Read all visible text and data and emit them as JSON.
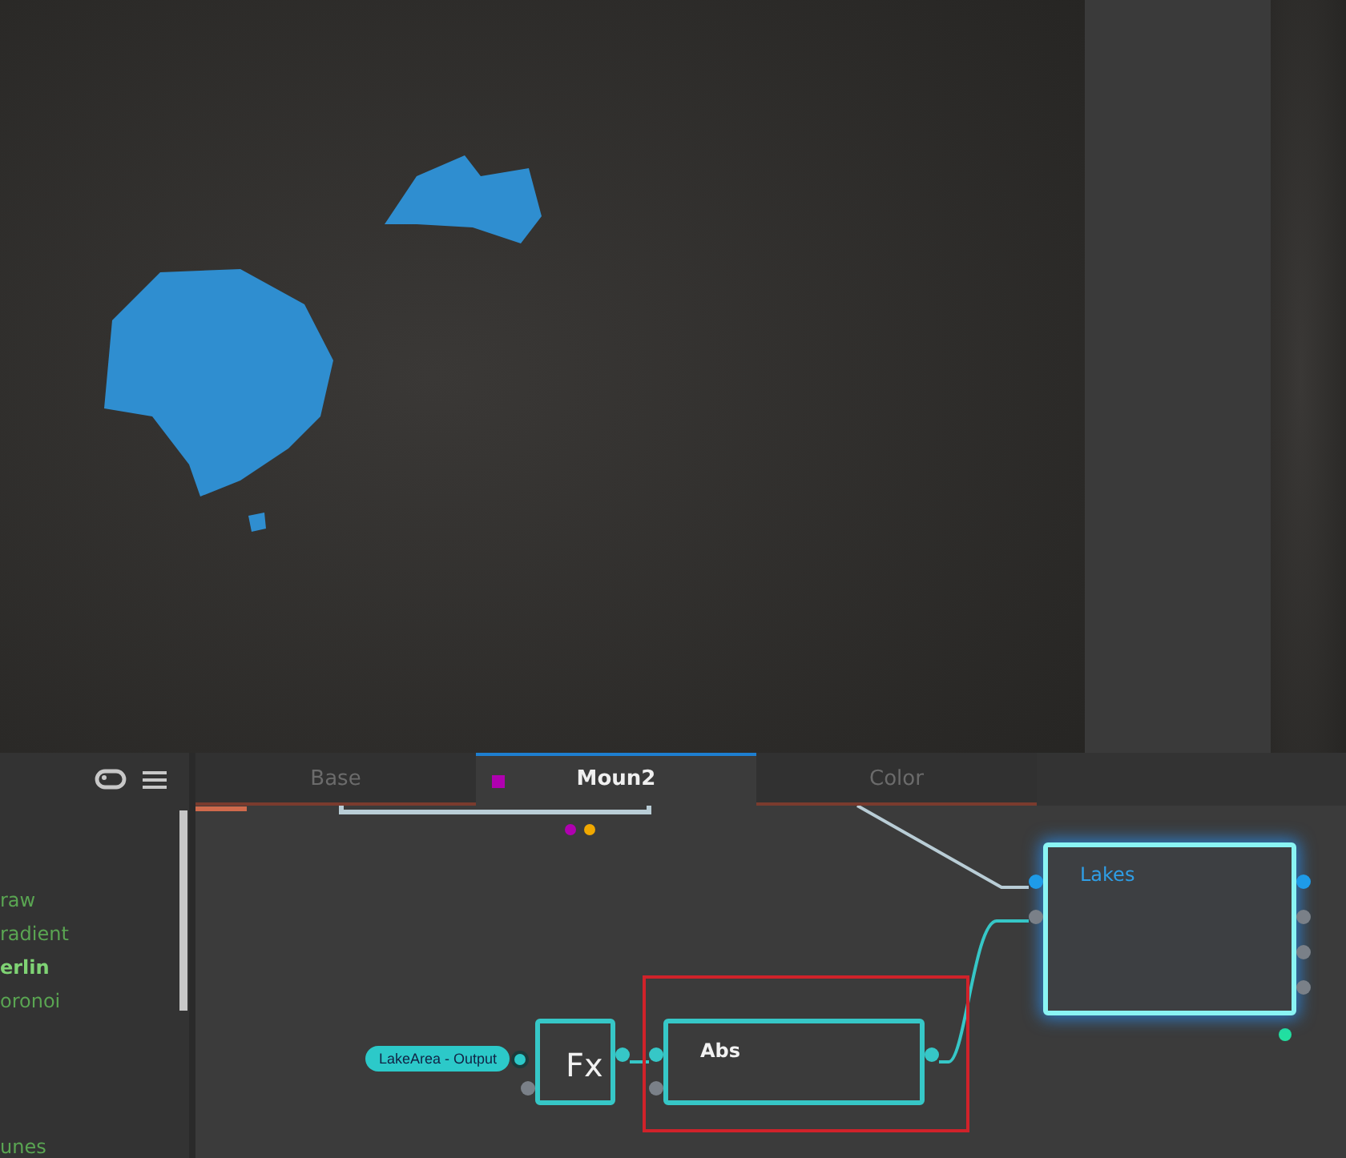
{
  "sidebar": {
    "items": [
      {
        "label": "raw",
        "selected": false
      },
      {
        "label": "radient",
        "selected": false
      },
      {
        "label": "erlin",
        "selected": true
      },
      {
        "label": "oronoi",
        "selected": false
      },
      {
        "label": "unes",
        "selected": false
      }
    ]
  },
  "tabs": [
    {
      "label": "Base",
      "selected": false
    },
    {
      "label": "Moun2",
      "selected": true
    },
    {
      "label": "Color",
      "selected": false
    }
  ],
  "nodes": [
    {
      "kind": "pill",
      "label": "LakeArea - Output"
    },
    {
      "kind": "fx",
      "label": "Fx",
      "selected": false,
      "highlighted": false
    },
    {
      "kind": "node",
      "label": "Abs",
      "selected": false,
      "highlighted": true
    },
    {
      "kind": "node",
      "label": "Lakes",
      "selected": true,
      "highlighted": false
    }
  ]
}
